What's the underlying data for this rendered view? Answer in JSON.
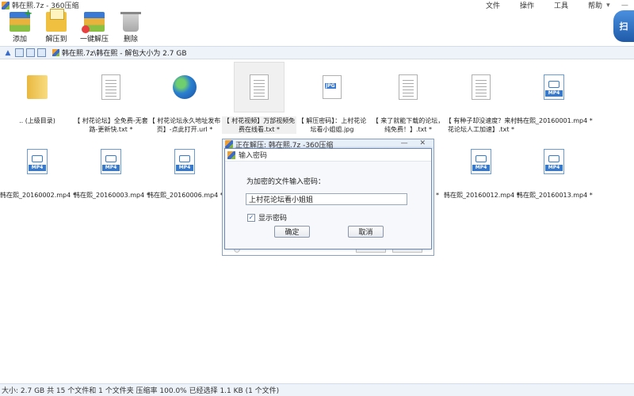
{
  "window": {
    "title": "韩在熙.7z - 360压缩",
    "menus": [
      "文件",
      "操作",
      "工具",
      "帮助"
    ],
    "controls": [
      "▾",
      "—"
    ]
  },
  "toolbar": {
    "add_label": "添加",
    "extract_label": "解压到",
    "onekey_label": "一键解压",
    "delete_label": "删除"
  },
  "shield_label": "扫",
  "address": {
    "path": "韩在熙.7z\\韩在熙 - 解包大小为 2.7 GB"
  },
  "files_row1": [
    {
      "name": ".. (上级目录)",
      "icon": "folder-icon"
    },
    {
      "name": "【 村花论坛】全免费-无套路-更新快.txt *",
      "icon": "text-file-icon"
    },
    {
      "name": "【 村花论坛永久地址发布页】-点此打开.url *",
      "icon": "globe-icon"
    },
    {
      "name": "【 村花视频】万部视频免费在线看.txt *",
      "icon": "text-file-icon"
    },
    {
      "name": "【 解压密码】：上村花论坛看小姐姐.jpg",
      "icon": "jpg-file-icon"
    },
    {
      "name": "【 来了就能下载的论坛，纯免费！】.txt *",
      "icon": "text-file-icon"
    },
    {
      "name": "【 有种子却没速度？来村花论坛人工加速】.txt *",
      "icon": "text-file-icon"
    },
    {
      "name": "韩在熙_20160001.mp4 *",
      "icon": "mp4-file-icon"
    }
  ],
  "files_row2": [
    {
      "name": "韩在熙_20160002.mp4 *",
      "icon": "mp4-file-icon"
    },
    {
      "name": "韩在熙_20160003.mp4 *",
      "icon": "mp4-file-icon"
    },
    {
      "name": "韩在熙_20160006.mp4 *",
      "icon": "mp4-file-icon"
    },
    {
      "name": "*",
      "icon": "mp4-file-icon"
    },
    {
      "name": "韩在熙_20160012.mp4 *",
      "icon": "mp4-file-icon"
    },
    {
      "name": "韩在熙_20160013.mp4 *",
      "icon": "mp4-file-icon"
    }
  ],
  "mp4_tag": "MP4",
  "jpg_tag": "JPG",
  "progress_dialog": {
    "title": "正在解压: 韩在熙.7z -360压缩",
    "controls": "— ✕"
  },
  "password_dialog": {
    "title": "输入密码",
    "prompt": "为加密的文件输入密码：",
    "value": "上村花论坛看小姐姐",
    "show_password_label": "显示密码",
    "show_password_checked": "✓",
    "ok_label": "确定",
    "cancel_label": "取消"
  },
  "status": {
    "text": "大小: 2.7 GB 共 15 个文件和 1 个文件夹 压缩率 100.0% 已经选择 1.1 KB (1 个文件)"
  }
}
